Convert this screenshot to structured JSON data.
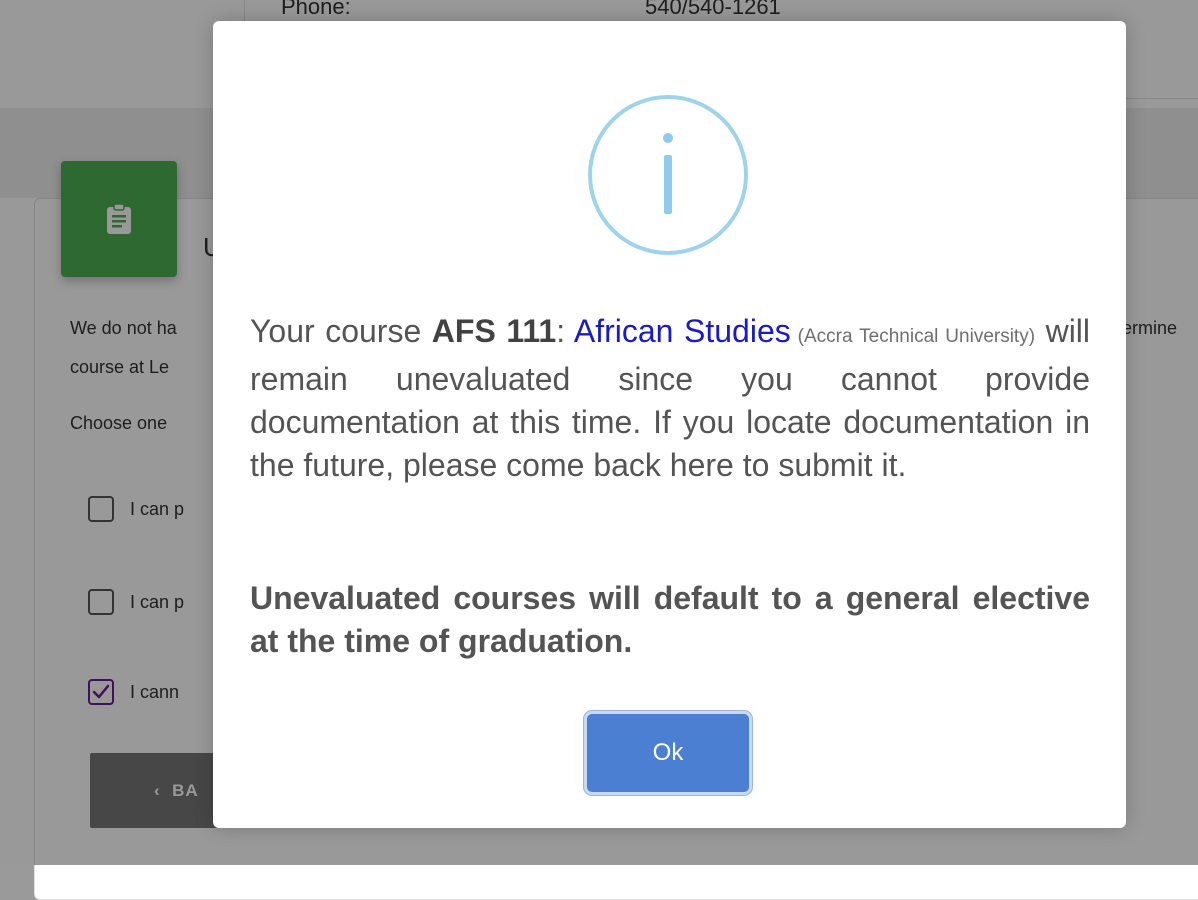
{
  "background": {
    "contact": {
      "label": "Phone:",
      "value": "540/540-1261"
    },
    "card": {
      "title": "U",
      "intro_line_1": "We do not ha",
      "intro_line_2": "course at Le",
      "intro_right": "ermine",
      "choose_text": "Choose one",
      "options": [
        {
          "label": "I can p",
          "checked": false
        },
        {
          "label": "I can p",
          "checked": false
        },
        {
          "label": "I cann",
          "checked": true
        }
      ],
      "back_label": "BA"
    }
  },
  "modal": {
    "icon": "info-icon",
    "icon_color": "#9fd3ec",
    "message": {
      "prefix": "Your course ",
      "course_code": "AFS 111",
      "separator": ": ",
      "course_name": "African Studies",
      "course_school": " (Accra Technical University)",
      "suffix": " will remain unevaluated since you cannot provide documentation at this time. If you locate documentation in the future, please come back here to submit it."
    },
    "warning": "Unevaluated courses will default to a general elective at the time of graduation.",
    "ok_label": "Ok"
  },
  "colors": {
    "modal_button": "#4a7fd1",
    "course_link": "#1a1ac8",
    "card_icon_tile": "#4caf50"
  }
}
